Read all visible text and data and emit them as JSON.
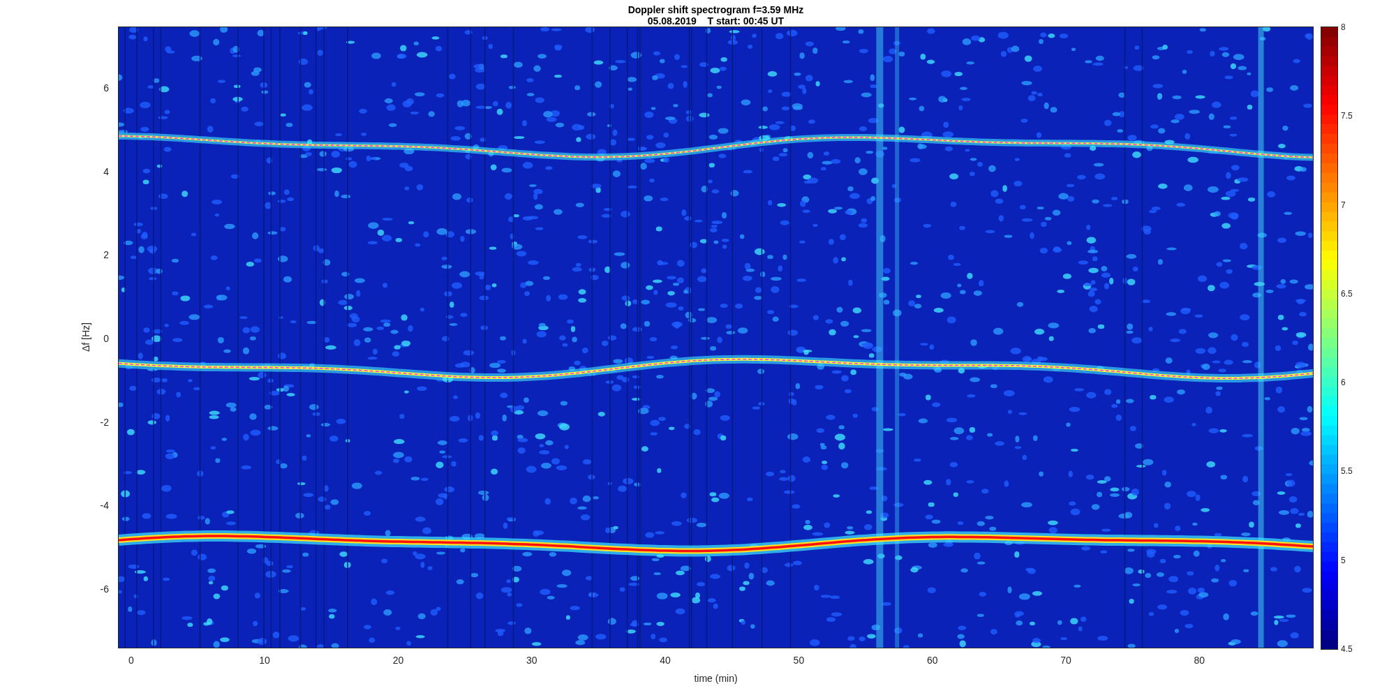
{
  "title": [
    "Doppler shift spectrogram f=3.59 MHz",
    "05.08.2019    T start: 00:45 UT"
  ],
  "y_axis": {
    "label": "Δf [Hz]",
    "ticks": [
      "6",
      "4",
      "2",
      "0",
      "-2",
      "-4",
      "-6"
    ]
  },
  "x_axis": {
    "label": "time (min)",
    "ticks": [
      "0",
      "10",
      "20",
      "30",
      "40",
      "50",
      "60",
      "70",
      "80"
    ]
  },
  "colorbar": {
    "ticks": [
      "8",
      "7.5",
      "7",
      "6.5",
      "6",
      "5.5",
      "5",
      "4.5"
    ]
  }
}
